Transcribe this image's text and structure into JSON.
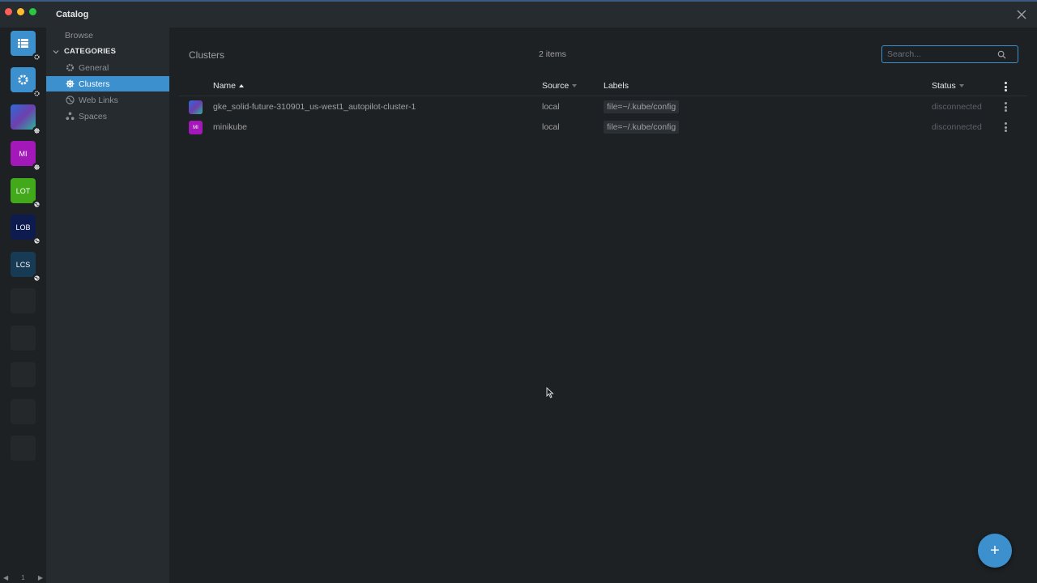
{
  "window": {
    "title": "Catalog"
  },
  "hotbar": {
    "items": [
      {
        "initials": "",
        "color": "#3d90ce",
        "icon": "list-icon"
      },
      {
        "initials": "",
        "color": "#3d90ce",
        "icon": "gear-icon"
      },
      {
        "initials": "",
        "color": "#6e3fae"
      },
      {
        "initials": "MI",
        "color": "#a318b8"
      },
      {
        "initials": "LOT",
        "color": "#41a91a"
      },
      {
        "initials": "LOB",
        "color": "#0d1b4f"
      },
      {
        "initials": "LCS",
        "color": "#173a55"
      }
    ],
    "page": "1"
  },
  "sidebar": {
    "browse": "Browse",
    "categories_label": "CATEGORIES",
    "items": [
      {
        "label": "General",
        "icon": "gear-icon"
      },
      {
        "label": "Clusters",
        "icon": "helm-icon"
      },
      {
        "label": "Web Links",
        "icon": "globe-icon"
      },
      {
        "label": "Spaces",
        "icon": "spaces-icon"
      }
    ]
  },
  "main": {
    "breadcrumb": "Clusters",
    "count": "2 items",
    "search_placeholder": "Search...",
    "columns": {
      "name": "Name",
      "source": "Source",
      "labels": "Labels",
      "status": "Status"
    },
    "rows": [
      {
        "avatar": "",
        "avatar_color": "#6e3fae",
        "name": "gke_solid-future-310901_us-west1_autopilot-cluster-1",
        "source": "local",
        "label": "file=~/.kube/config",
        "status": "disconnected"
      },
      {
        "avatar": "MI",
        "avatar_color": "#a318b8",
        "name": "minikube",
        "source": "local",
        "label": "file=~/.kube/config",
        "status": "disconnected"
      }
    ]
  },
  "fab": {
    "label": "+"
  }
}
